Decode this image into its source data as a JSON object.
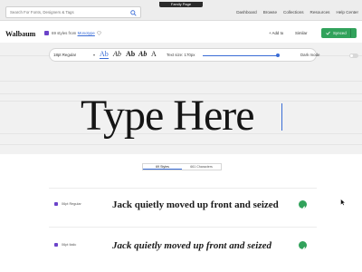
{
  "browser": {
    "tab_title": "Family Page"
  },
  "search": {
    "placeholder": "Search For Fonts, Designers & Tags"
  },
  "nav": [
    "Dashboard",
    "Browse",
    "Collections",
    "Resources",
    "Help Center"
  ],
  "font_header": {
    "name": "Walbaum",
    "styles_prefix": "69 styles from ",
    "foundry": "Monotype",
    "add_to_label": "+ Add to",
    "similar_label": "Similar",
    "synced_label": "Synced"
  },
  "toolbar": {
    "style_select_value": "18pt Regular",
    "glyph_options": [
      "Ab",
      "Ab",
      "Ab",
      "Ab",
      "A"
    ],
    "text_size_label": "Text size: 170px",
    "text_size_fraction": 0.99,
    "dark_mode_label": "Dark mode",
    "dark_mode_on": false
  },
  "preview": {
    "text": "Type Here"
  },
  "tabs": [
    {
      "label": "69 Styles",
      "active": true
    },
    {
      "label": "661 Characters",
      "active": false
    }
  ],
  "style_rows": [
    {
      "name": "06pt Regular",
      "sample": "Jack quietly moved up front and seized",
      "italic": false,
      "synced": true
    },
    {
      "name": "06pt Italic",
      "sample": "Jack quietly moved up front and seized",
      "italic": true,
      "synced": true
    }
  ],
  "colors": {
    "accent_blue": "#3a6cd6",
    "synced_green": "#31a25b",
    "adobe_badge_purple": "#6b43c9"
  }
}
